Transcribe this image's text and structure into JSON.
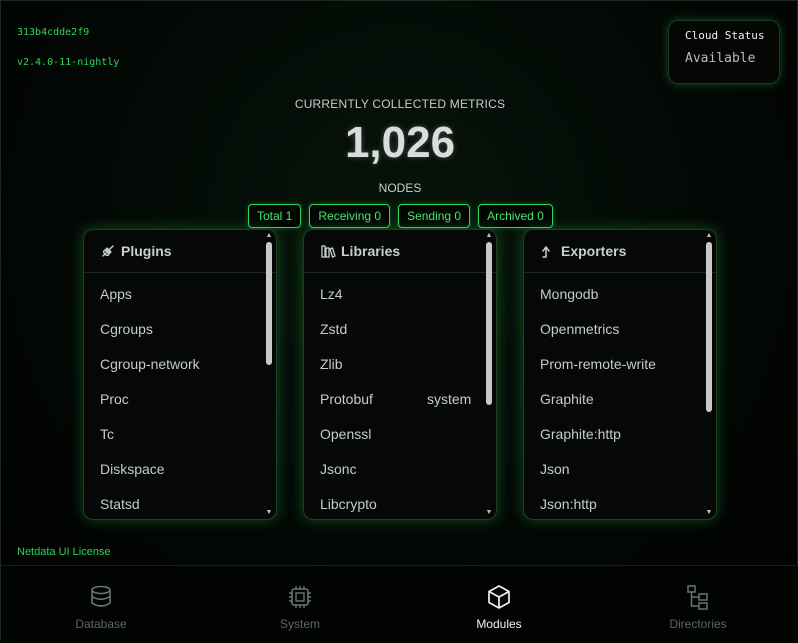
{
  "build": {
    "hash": "313b4cdde2f9",
    "version": "v2.4.0-11-nightly"
  },
  "cloud_status": {
    "title": "Cloud Status",
    "value": "Available"
  },
  "metrics": {
    "title": "CURRENTLY COLLECTED METRICS",
    "value": "1,026"
  },
  "nodes": {
    "title": "NODES",
    "chips": [
      "Total 1",
      "Receiving 0",
      "Sending 0",
      "Archived 0"
    ]
  },
  "panels": {
    "plugins": {
      "title": "Plugins",
      "icon": "plug-icon",
      "items": [
        "Apps",
        "Cgroups",
        "Cgroup-network",
        "Proc",
        "Tc",
        "Diskspace",
        "Statsd"
      ]
    },
    "libraries": {
      "title": "Libraries",
      "icon": "library-icon",
      "items": [
        "Lz4",
        "Zstd",
        "Zlib",
        "Protobuf",
        "Openssl",
        "Jsonc",
        "Libcrypto"
      ],
      "protobuf_extra": "system"
    },
    "exporters": {
      "title": "Exporters",
      "icon": "export-arrow-icon",
      "items": [
        "Mongodb",
        "Openmetrics",
        "Prom-remote-write",
        "Graphite",
        "Graphite:http",
        "Json",
        "Json:http"
      ]
    }
  },
  "license": "Netdata UI License",
  "footer": {
    "tabs": [
      {
        "label": "Database",
        "icon": "database-icon",
        "active": false
      },
      {
        "label": "System",
        "icon": "chip-icon",
        "active": false
      },
      {
        "label": "Modules",
        "icon": "cube-icon",
        "active": true
      },
      {
        "label": "Directories",
        "icon": "folder-tree-icon",
        "active": false
      }
    ]
  },
  "colors": {
    "accent": "#2fd55a",
    "background": "#000000",
    "text": "#c6ccc8"
  }
}
